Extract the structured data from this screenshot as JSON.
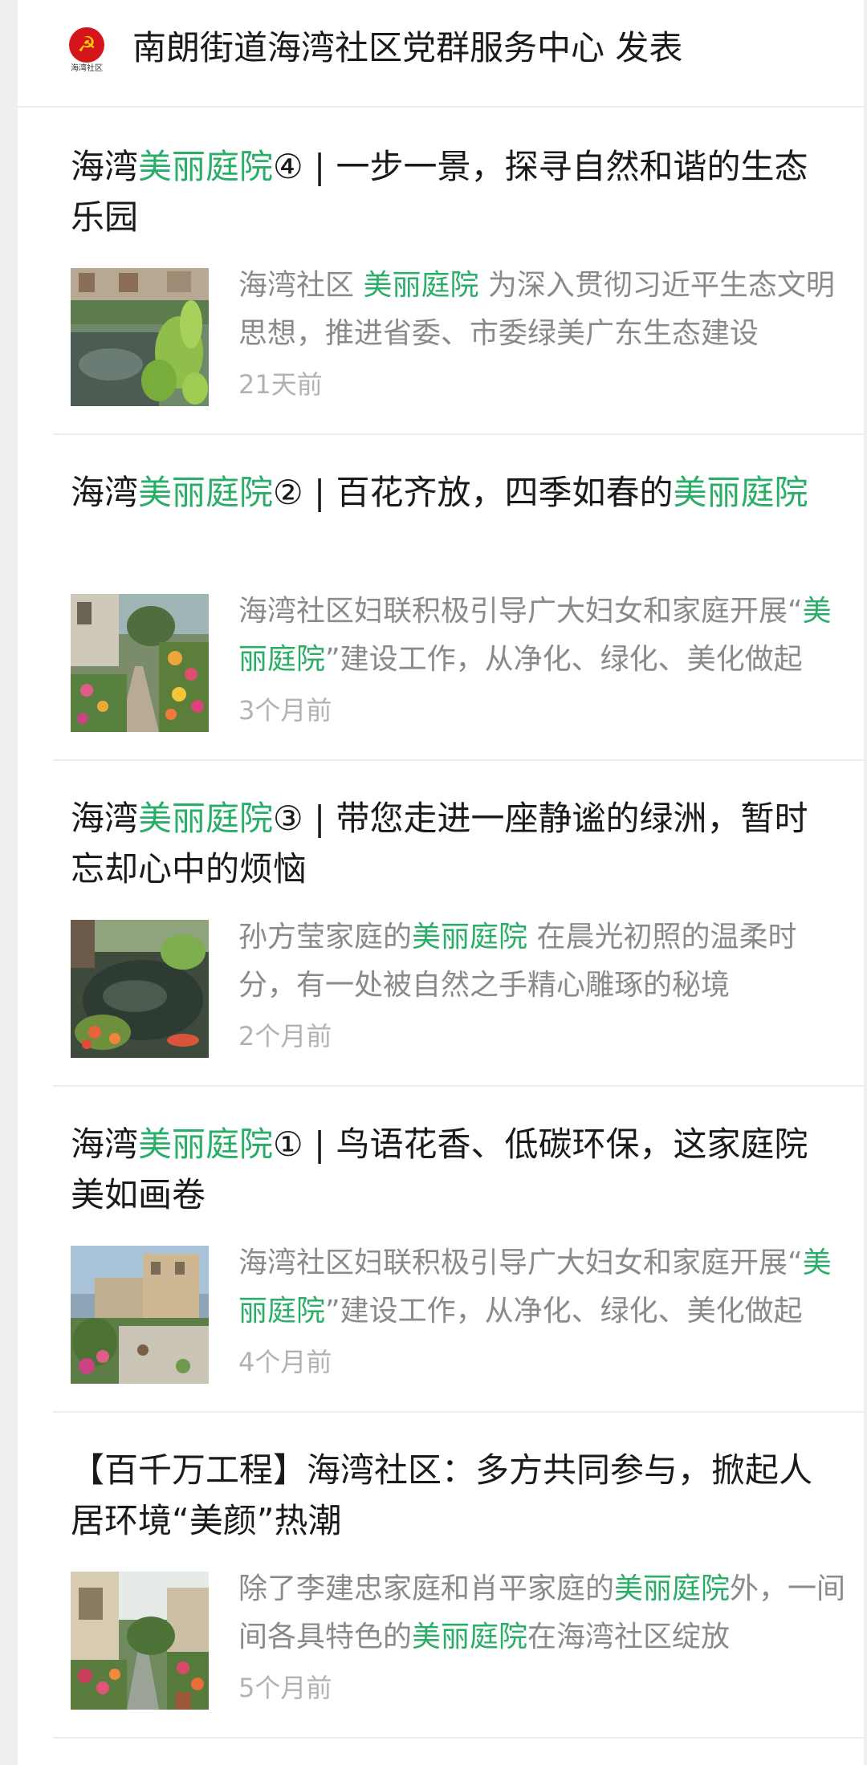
{
  "header": {
    "account_name": "南朗街道海湾社区党群服务中心",
    "action": "发表",
    "logo_text": "海湾社区"
  },
  "colors": {
    "highlight": "#2aae67",
    "title": "#1a1a1a",
    "excerpt": "#8a8a8a",
    "time": "#b2b2b2"
  },
  "articles": [
    {
      "title": [
        {
          "text": "海湾"
        },
        {
          "text": "美丽庭院",
          "hl": true
        },
        {
          "text": "④ | 一步一景，探寻自然和谐的生态乐园"
        }
      ],
      "excerpt": [
        {
          "text": "海湾社区 "
        },
        {
          "text": "美丽庭院",
          "hl": true
        },
        {
          "text": " 为深入贯彻习近平生态文明思想，推进省委、市委绿美广东生态建设"
        }
      ],
      "time": "21天前",
      "thumbnail": "garden-pond-photo"
    },
    {
      "title": [
        {
          "text": "海湾"
        },
        {
          "text": "美丽庭院",
          "hl": true
        },
        {
          "text": "② | 百花齐放，四季如春的"
        },
        {
          "text": "美丽庭院",
          "hl": true
        }
      ],
      "excerpt": [
        {
          "text": "海湾社区妇联积极引导广大妇女和家庭开展“"
        },
        {
          "text": "美丽庭院",
          "hl": true
        },
        {
          "text": "”建设工作，从净化、绿化、美化做起"
        }
      ],
      "time": "3个月前",
      "thumbnail": "flower-garden-photo"
    },
    {
      "title": [
        {
          "text": "海湾"
        },
        {
          "text": "美丽庭院",
          "hl": true
        },
        {
          "text": "③ | 带您走进一座静谧的绿洲，暂时忘却心中的烦恼"
        }
      ],
      "excerpt": [
        {
          "text": "孙方莹家庭的"
        },
        {
          "text": "美丽庭院",
          "hl": true
        },
        {
          "text": " 在晨光初照的温柔时分，有一处被自然之手精心雕琢的秘境"
        }
      ],
      "time": "2个月前",
      "thumbnail": "koi-pond-photo"
    },
    {
      "title": [
        {
          "text": "海湾"
        },
        {
          "text": "美丽庭院",
          "hl": true
        },
        {
          "text": "① | 鸟语花香、低碳环保，这家庭院美如画卷"
        }
      ],
      "excerpt": [
        {
          "text": "海湾社区妇联积极引导广大妇女和家庭开展“"
        },
        {
          "text": "美丽庭院",
          "hl": true
        },
        {
          "text": "”建设工作，从净化、绿化、美化做起"
        }
      ],
      "time": "4个月前",
      "thumbnail": "terrace-garden-photo"
    },
    {
      "title": [
        {
          "text": "【百千万工程】海湾社区：多方共同参与，掀起人居环境“美颜”热潮"
        }
      ],
      "excerpt": [
        {
          "text": "除了李建忠家庭和肖平家庭的"
        },
        {
          "text": "美丽庭院",
          "hl": true
        },
        {
          "text": "外，一间间各具特色的"
        },
        {
          "text": "美丽庭院",
          "hl": true
        },
        {
          "text": "在海湾社区绽放"
        }
      ],
      "time": "5个月前",
      "thumbnail": "courtyard-photo"
    }
  ]
}
